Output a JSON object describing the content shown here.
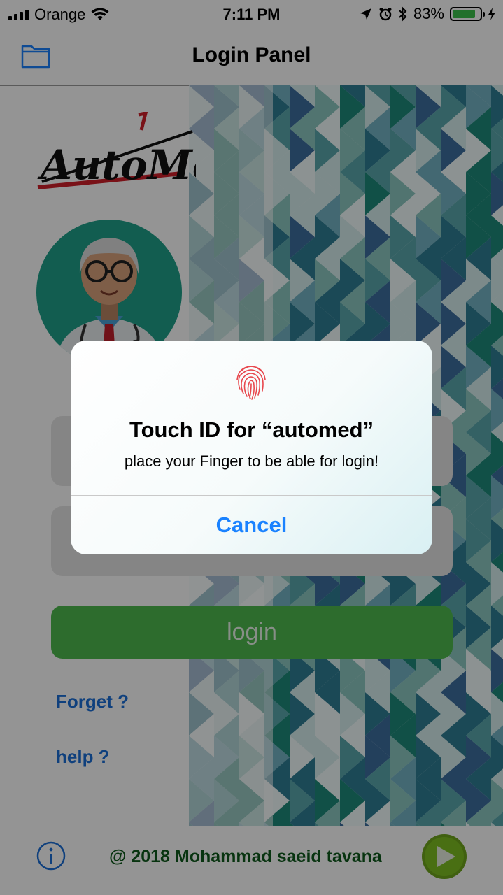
{
  "status_bar": {
    "carrier": "Orange",
    "time": "7:11 PM",
    "battery_percent": "83%",
    "battery_level": 0.83,
    "icons": [
      "signal-bars-icon",
      "wifi-icon",
      "location-arrow-icon",
      "alarm-clock-icon",
      "bluetooth-icon",
      "battery-icon",
      "charging-bolt-icon"
    ]
  },
  "nav": {
    "title": "Login Panel",
    "left_icon": "folder-icon"
  },
  "logo": {
    "text": "AutoMed",
    "colors": {
      "text": "#111111",
      "accent": "#d0202a"
    }
  },
  "avatar": {
    "icon": "doctor-avatar-icon",
    "background": "#1fa08a"
  },
  "form": {
    "username_placeholder": "",
    "password_placeholder": "",
    "login_label": "login",
    "login_color": "#4fba4f"
  },
  "links": {
    "forget": "Forget ?",
    "help": "help ?",
    "color": "#1a6ed8"
  },
  "footer": {
    "info_icon": "info-icon",
    "copyright": "@ 2018 Mohammad saeid tavana",
    "play_icon": "play-button-icon"
  },
  "alert": {
    "icon": "fingerprint-icon",
    "title": "Touch ID for “automed”",
    "message": "place your Finger to be able for login!",
    "cancel_label": "Cancel",
    "cancel_color": "#1a82ff",
    "fingerprint_color": "#e8474d"
  }
}
